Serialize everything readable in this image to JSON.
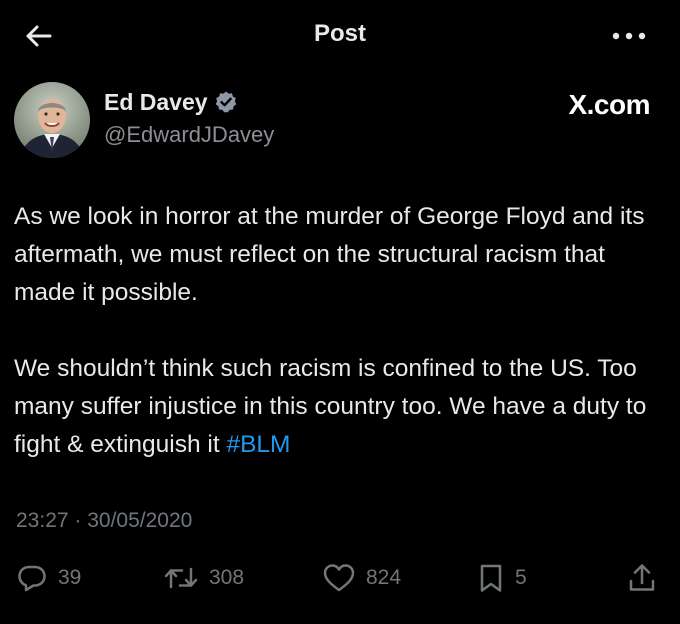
{
  "header": {
    "title": "Post",
    "back_icon": "arrow-left-icon",
    "more_icon": "more-horizontal-icon"
  },
  "author": {
    "display_name": "Ed Davey",
    "handle": "@EdwardJDavey",
    "verified_icon": "verified-badge-icon",
    "verified_color": "#8b98a5",
    "avatar_icon": "profile-avatar"
  },
  "source_label": "X.com",
  "tweet": {
    "text_part1": "As we look in horror at the murder of George Floyd and its aftermath, we must reflect on the structural racism that made it possible.",
    "text_part2_prefix": "We shouldn’t think such racism is confined to the US. Too many suffer injustice in this country too. We have a duty to fight & extinguish it ",
    "hashtag": "#BLM",
    "hashtag_color": "#1d9bf0"
  },
  "timestamp": "23:27 · 30/05/2020",
  "actions": {
    "reply": {
      "icon": "reply-icon",
      "count": "39"
    },
    "repost": {
      "icon": "repost-icon",
      "count": "308"
    },
    "like": {
      "icon": "heart-icon",
      "count": "824"
    },
    "bookmark": {
      "icon": "bookmark-icon",
      "count": "5"
    },
    "share": {
      "icon": "share-icon"
    }
  },
  "colors": {
    "background": "#000000",
    "text": "#e7e9ea",
    "secondary_text": "#71767b",
    "accent": "#1d9bf0"
  }
}
